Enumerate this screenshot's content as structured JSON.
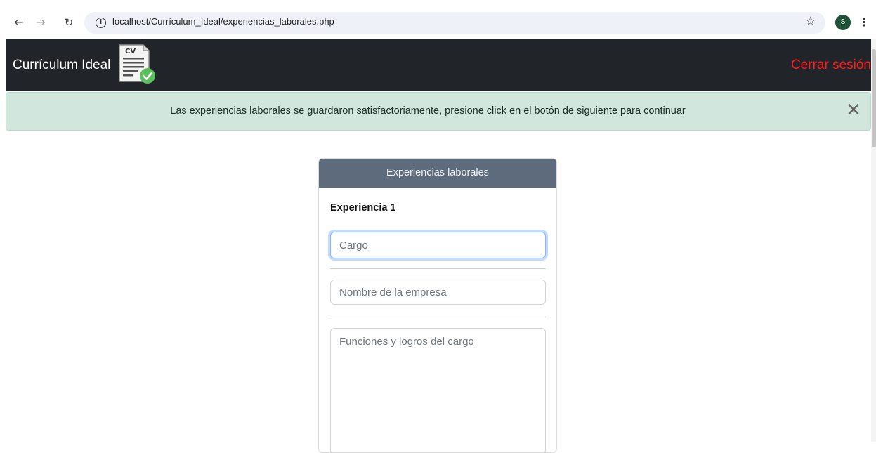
{
  "browser": {
    "url": "localhost/Currículum_Ideal/experiencias_laborales.php",
    "profile_initial": "S"
  },
  "navbar": {
    "brand": "Currículum Ideal",
    "logo_text": "CV",
    "logout_label": "Cerrar sesión"
  },
  "alert": {
    "message": "Las experiencias laborales se guardaron satisfactoriamente, presione click en el botón de siguiente para continuar",
    "close_glyph": "✕"
  },
  "card": {
    "header": "Experiencias laborales",
    "experience_title": "Experiencia 1",
    "cargo_placeholder": "Cargo",
    "empresa_placeholder": "Nombre de la empresa",
    "funciones_placeholder": "Funciones y logros del cargo"
  },
  "colors": {
    "navbar_bg": "#212529",
    "logout": "#ff1f1f",
    "alert_bg": "#d1e7dd",
    "card_header_bg": "#5d6b7c"
  }
}
